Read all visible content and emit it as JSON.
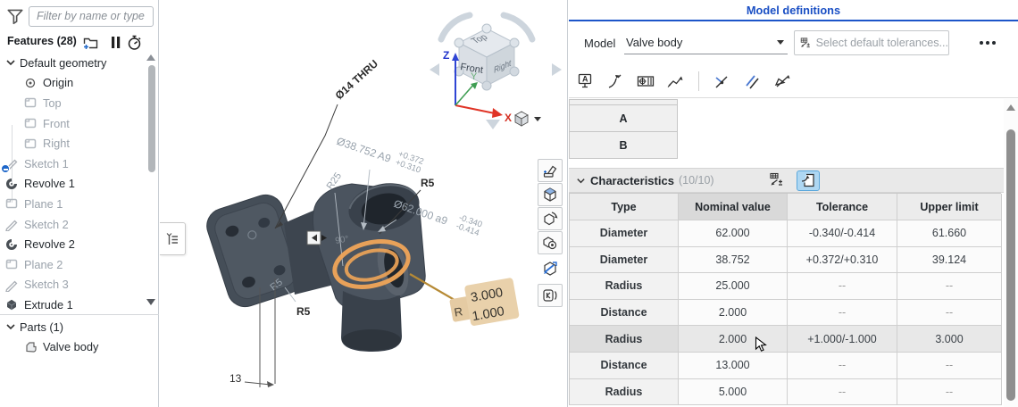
{
  "sidebar": {
    "filter_placeholder": "Filter by name or type",
    "features_label": "Features (28)",
    "tree": [
      {
        "label": "Default geometry"
      },
      {
        "label": "Origin"
      },
      {
        "label": "Top"
      },
      {
        "label": "Front"
      },
      {
        "label": "Right"
      },
      {
        "label": "Sketch 1"
      },
      {
        "label": "Revolve 1"
      },
      {
        "label": "Plane 1"
      },
      {
        "label": "Sketch 2"
      },
      {
        "label": "Revolve 2"
      },
      {
        "label": "Plane 2"
      },
      {
        "label": "Sketch 3"
      },
      {
        "label": "Extrude 1"
      }
    ],
    "parts_label": "Parts (1)",
    "parts": [
      {
        "label": "Valve body"
      }
    ]
  },
  "viewport": {
    "view_cube": {
      "top": "Top",
      "front": "Front",
      "right": "Right"
    },
    "axes": {
      "x": "X",
      "y": "Y",
      "z": "Z"
    },
    "dims": {
      "hole_callout": "Ø14 THRU",
      "dia38_main": "Ø38.752 A9",
      "dia38_upper": "+0.372",
      "dia38_lower": "+0.310",
      "r25": "R25",
      "r5_top": "R5",
      "dia62_main": "Ø62.000 a9",
      "dia62_upper": "-0.340",
      "dia62_lower": "-0.414",
      "r5_small": "R5",
      "r5_mid": "R5",
      "dist13": "13",
      "angle": "90°"
    },
    "tooltip": {
      "prefix": "R",
      "upper": "3.000",
      "lower": "1.000"
    }
  },
  "panel": {
    "title": "Model definitions",
    "model_label": "Model",
    "model_value": "Valve body",
    "tolerance_placeholder": "Select default tolerances...",
    "toolbar": {
      "datum_letter": "A"
    },
    "datum_rows": [
      "A",
      "B"
    ],
    "characteristics_title": "Characteristics",
    "characteristics_count": "(10/10)",
    "table": {
      "headers": [
        "Type",
        "Nominal value",
        "Tolerance",
        "Upper limit"
      ],
      "rows": [
        [
          "Diameter",
          "62.000",
          "-0.340/-0.414",
          "61.660"
        ],
        [
          "Diameter",
          "38.752",
          "+0.372/+0.310",
          "39.124"
        ],
        [
          "Radius",
          "25.000",
          "--",
          "--"
        ],
        [
          "Distance",
          "2.000",
          "--",
          "--"
        ],
        [
          "Radius",
          "2.000",
          "+1.000/-1.000",
          "3.000"
        ],
        [
          "Distance",
          "13.000",
          "--",
          "--"
        ],
        [
          "Radius",
          "5.000",
          "--",
          "--"
        ]
      ]
    }
  },
  "colors": {
    "accent_blue": "#1a4fc4",
    "selection_blue": "#aed7f2",
    "highlight_orange": "#f0a558",
    "tooltip_tan": "#e7cea7",
    "leader_gold": "#b68a35"
  }
}
